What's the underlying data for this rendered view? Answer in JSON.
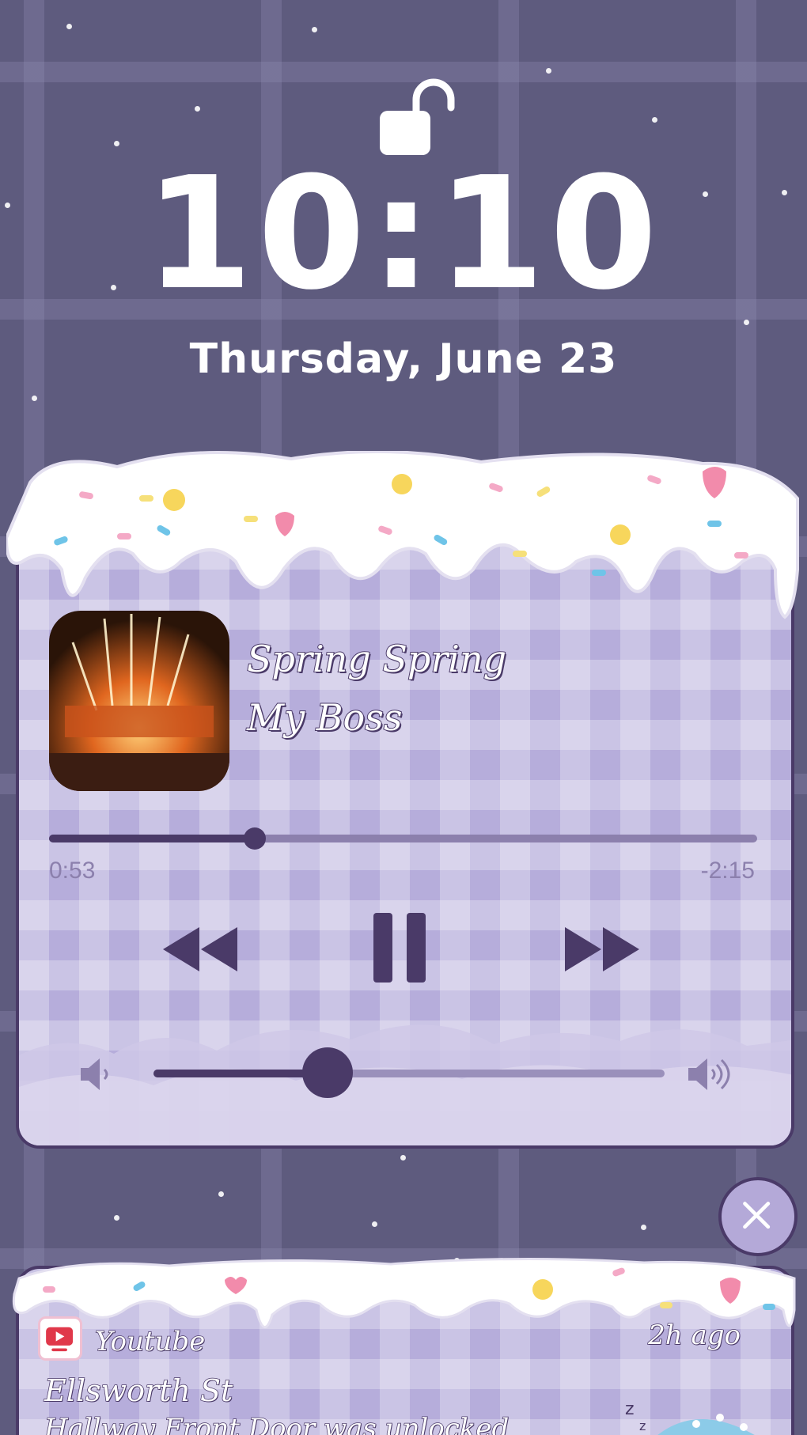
{
  "lockscreen": {
    "lock_icon": "unlocked-padlock-icon",
    "time": "10:10",
    "date": "Thursday, June 23"
  },
  "player": {
    "album_art": "concert-fireworks-album-art",
    "title": "Spring Spring",
    "artist": "My Boss",
    "progress_fraction": 0.29,
    "elapsed": "0:53",
    "remaining": "-2:15",
    "controls": {
      "rewind_icon": "rewind-icon",
      "pause_icon": "pause-icon",
      "forward_icon": "fast-forward-icon"
    },
    "volume_fraction": 0.34,
    "volume_low_icon": "volume-low-icon",
    "volume_high_icon": "volume-high-icon"
  },
  "dismiss": {
    "icon": "close-icon"
  },
  "notification": {
    "app_icon": "youtube-icon",
    "app": "Youtube",
    "time": "2h ago",
    "title": "Ellsworth St",
    "body": "Hallway Front Door was unlocked"
  },
  "colors": {
    "background": "#5e5b7e",
    "card": "#b6addb",
    "accent_dark": "#4a3a68",
    "track": "#8c80ad",
    "icing": "#ffffff"
  }
}
